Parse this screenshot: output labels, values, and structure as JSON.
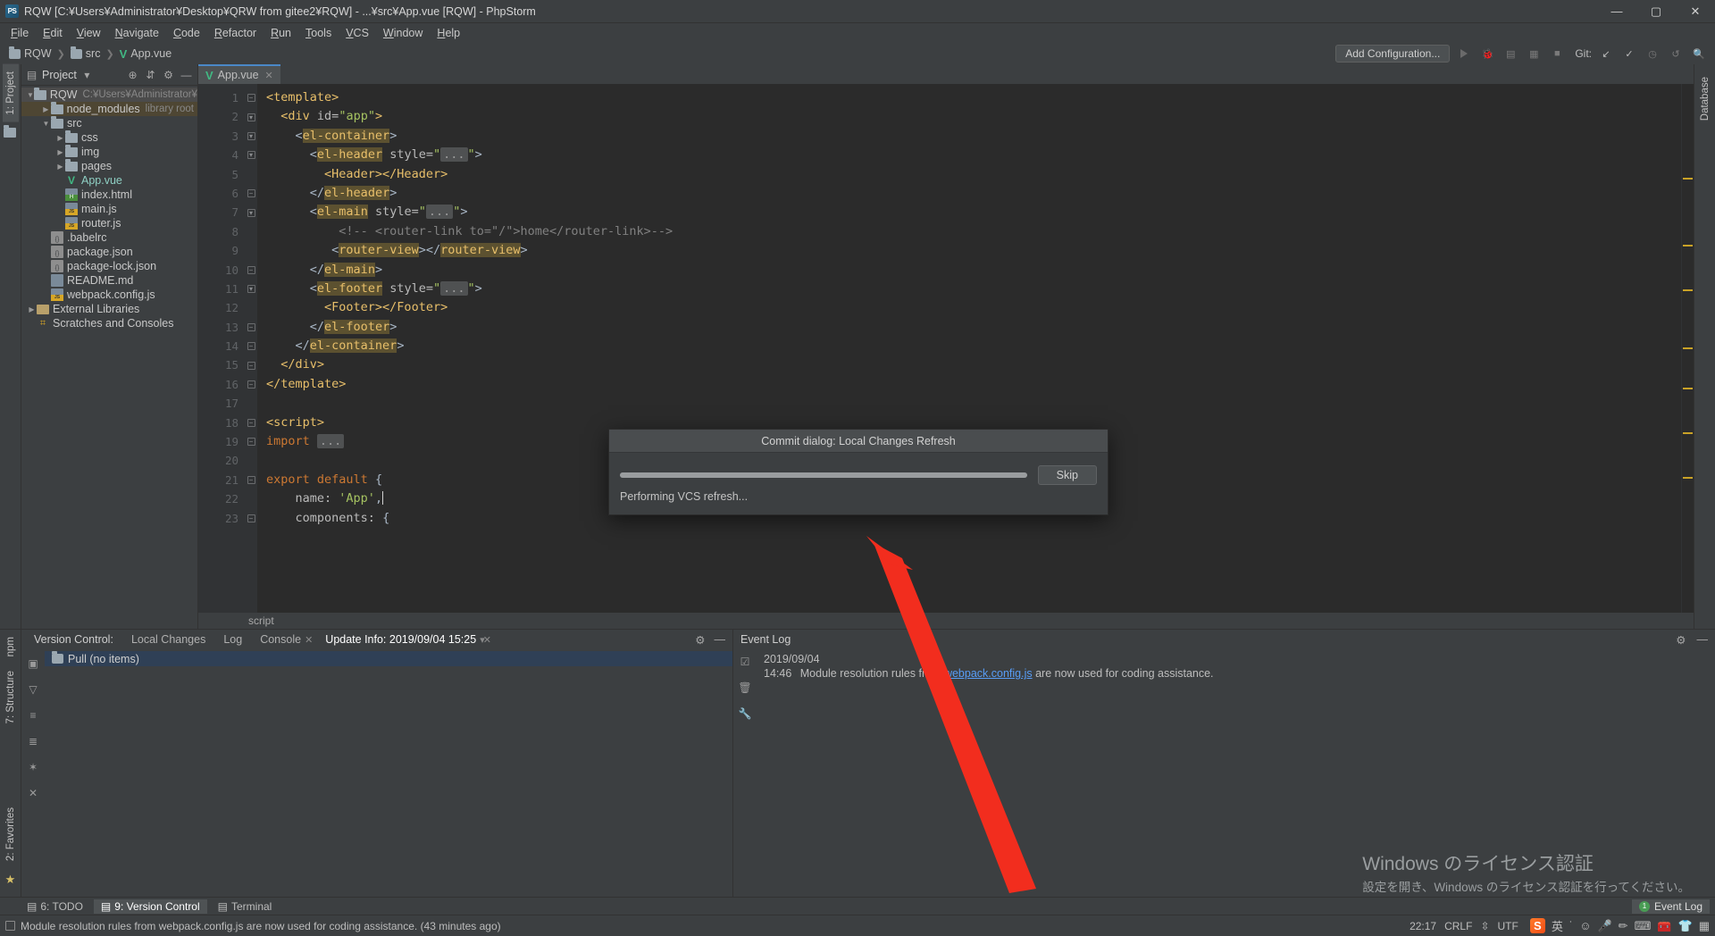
{
  "window": {
    "title": "RQW [C:¥Users¥Administrator¥Desktop¥QRW from gitee2¥RQW] - ...¥src¥App.vue [RQW] - PhpStorm",
    "logo": "PS",
    "minimize": "—",
    "maximize": "▢",
    "close": "✕"
  },
  "menu": [
    "File",
    "Edit",
    "View",
    "Navigate",
    "Code",
    "Refactor",
    "Run",
    "Tools",
    "VCS",
    "Window",
    "Help"
  ],
  "navbar": {
    "crumbs": [
      "RQW",
      "src",
      "App.vue"
    ],
    "add_configuration": "Add Configuration...",
    "git_label": "Git:"
  },
  "left_strip": {
    "project_tab": "1: Project"
  },
  "right_strip": {
    "database_tab": "Database"
  },
  "left_bottom_strips": {
    "npm_tab": "npm",
    "structure_tab": "7: Structure",
    "favorites_tab": "2: Favorites"
  },
  "project_panel": {
    "title": "Project",
    "tree": [
      {
        "indent": 0,
        "arrow": "down",
        "icon": "folder",
        "label": "RQW",
        "hint": "C:¥Users¥Administrator¥Desktop¥",
        "state": "selected-root"
      },
      {
        "indent": 1,
        "arrow": "right",
        "icon": "folder",
        "label": "node_modules",
        "hint": "library root",
        "state": "highlighted"
      },
      {
        "indent": 1,
        "arrow": "down",
        "icon": "folder",
        "label": "src",
        "hint": ""
      },
      {
        "indent": 2,
        "arrow": "right",
        "icon": "folder",
        "label": "css",
        "hint": ""
      },
      {
        "indent": 2,
        "arrow": "right",
        "icon": "folder",
        "label": "img",
        "hint": ""
      },
      {
        "indent": 2,
        "arrow": "right",
        "icon": "folder",
        "label": "pages",
        "hint": ""
      },
      {
        "indent": 2,
        "arrow": "none",
        "icon": "vue",
        "label": "App.vue",
        "hint": "",
        "state": "active-file"
      },
      {
        "indent": 2,
        "arrow": "none",
        "icon": "html",
        "label": "index.html",
        "hint": ""
      },
      {
        "indent": 2,
        "arrow": "none",
        "icon": "js",
        "label": "main.js",
        "hint": ""
      },
      {
        "indent": 2,
        "arrow": "none",
        "icon": "js",
        "label": "router.js",
        "hint": ""
      },
      {
        "indent": 1,
        "arrow": "none",
        "icon": "json",
        "label": ".babelrc",
        "hint": ""
      },
      {
        "indent": 1,
        "arrow": "none",
        "icon": "json",
        "label": "package.json",
        "hint": ""
      },
      {
        "indent": 1,
        "arrow": "none",
        "icon": "json",
        "label": "package-lock.json",
        "hint": ""
      },
      {
        "indent": 1,
        "arrow": "none",
        "icon": "md",
        "label": "README.md",
        "hint": ""
      },
      {
        "indent": 1,
        "arrow": "none",
        "icon": "js",
        "label": "webpack.config.js",
        "hint": ""
      },
      {
        "indent": 0,
        "arrow": "right",
        "icon": "lib",
        "label": "External Libraries",
        "hint": ""
      },
      {
        "indent": 0,
        "arrow": "none",
        "icon": "scratch",
        "label": "Scratches and Consoles",
        "hint": ""
      }
    ]
  },
  "editor": {
    "tab": {
      "label": "App.vue",
      "icon": "vue-icon",
      "close": "✕"
    },
    "breadcrumb": "script",
    "lines": [
      {
        "n": 1,
        "fold": "minus",
        "html": "<span class='tag'>&lt;template&gt;</span>"
      },
      {
        "n": 2,
        "fold": "down",
        "html": "  <span class='tag'>&lt;div</span> <span class='attr'>id=</span><span class='str'>\"app\"</span><span class='tag'>&gt;</span>"
      },
      {
        "n": 3,
        "fold": "down",
        "html": "    <span class='punct'>&lt;</span><span class='tagbg'>el-container</span><span class='punct'>&gt;</span>"
      },
      {
        "n": 4,
        "fold": "down",
        "html": "      <span class='punct'>&lt;</span><span class='tagbg'>el-header</span> <span class='attr'>style=</span><span class='str'>\"</span><span class='fold-ell'>...</span><span class='str'>\"</span><span class='punct'>&gt;</span>"
      },
      {
        "n": 5,
        "fold": "none",
        "html": "        <span class='tag'>&lt;Header&gt;&lt;/Header&gt;</span>"
      },
      {
        "n": 6,
        "fold": "up",
        "html": "      <span class='punct'>&lt;/</span><span class='tagbg'>el-header</span><span class='punct'>&gt;</span>"
      },
      {
        "n": 7,
        "fold": "down",
        "html": "      <span class='punct'>&lt;</span><span class='tagbg'>el-main</span> <span class='attr'>style=</span><span class='str'>\"</span><span class='fold-ell'>...</span><span class='str'>\"</span><span class='punct'>&gt;</span>"
      },
      {
        "n": 8,
        "fold": "none",
        "html": "          <span class='cmt'>&lt;!-- &lt;router-link to=\"/\"&gt;home&lt;/router-link&gt;--&gt;</span>"
      },
      {
        "n": 9,
        "fold": "none",
        "html": "         <span class='punct'>&lt;</span><span class='tagbg'>router-view</span><span class='punct'>&gt;&lt;/</span><span class='tagbg'>router-view</span><span class='punct'>&gt;</span>"
      },
      {
        "n": 10,
        "fold": "up",
        "html": "      <span class='punct'>&lt;/</span><span class='tagbg'>el-main</span><span class='punct'>&gt;</span>"
      },
      {
        "n": 11,
        "fold": "down",
        "html": "      <span class='punct'>&lt;</span><span class='tagbg'>el-footer</span> <span class='attr'>style=</span><span class='str'>\"</span><span class='fold-ell'>...</span><span class='str'>\"</span><span class='punct'>&gt;</span>"
      },
      {
        "n": 12,
        "fold": "none",
        "html": "        <span class='tag'>&lt;Footer&gt;&lt;/Footer&gt;</span>"
      },
      {
        "n": 13,
        "fold": "up",
        "html": "      <span class='punct'>&lt;/</span><span class='tagbg'>el-footer</span><span class='punct'>&gt;</span>"
      },
      {
        "n": 14,
        "fold": "up",
        "html": "    <span class='punct'>&lt;/</span><span class='tagbg'>el-container</span><span class='punct'>&gt;</span>"
      },
      {
        "n": 15,
        "fold": "up",
        "html": "  <span class='tag'>&lt;/div&gt;</span>"
      },
      {
        "n": 16,
        "fold": "up",
        "html": "<span class='tag'>&lt;/template&gt;</span>"
      },
      {
        "n": 17,
        "fold": "none",
        "html": ""
      },
      {
        "n": 18,
        "fold": "minus",
        "html": "<span class='tag'>&lt;script&gt;</span>"
      },
      {
        "n": 19,
        "fold": "minus",
        "html": "<span class='kw'>import</span> <span class='fold-ell'>...</span>"
      },
      {
        "n": 20,
        "fold": "none",
        "html": ""
      },
      {
        "n": 21,
        "fold": "minus",
        "html": "<span class='kw'>export default</span> <span class='punct'>{</span>"
      },
      {
        "n": 22,
        "fold": "none",
        "html": "    <span class='attr'>name:</span> <span class='str'>'App'</span><span class='punct'>,</span><span class='caret'></span>"
      },
      {
        "n": 23,
        "fold": "minus",
        "html": "    <span class='attr'>components:</span> <span class='punct'>{</span>"
      }
    ]
  },
  "dialog": {
    "title": "Commit dialog: Local Changes Refresh",
    "status": "Performing VCS refresh...",
    "button": "Skip",
    "progress_percent": 100
  },
  "version_control": {
    "tabs": [
      "Version Control:",
      "Local Changes",
      "Log",
      "Console",
      "Update Info: 2019/09/04 15:25"
    ],
    "row": "Pull (no items)"
  },
  "event_log": {
    "title": "Event Log",
    "date": "2019/09/04",
    "time": "14:46",
    "message_before": "Module resolution rules from ",
    "link": "webpack.config.js",
    "message_after": " are now used for coding assistance."
  },
  "watermark": {
    "line1": "Windows のライセンス認証",
    "line2": "設定を開き、Windows のライセンス認証を行ってください。"
  },
  "tool_tabs": [
    {
      "label": "6: TODO",
      "selected": false
    },
    {
      "label": "9: Version Control",
      "selected": true
    },
    {
      "label": "Terminal",
      "selected": false
    }
  ],
  "event_log_button": {
    "label": "Event Log",
    "count": "1"
  },
  "statusbar": {
    "message": "Module resolution rules from webpack.config.js are now used for coding assistance. (43 minutes ago)",
    "time": "22:17",
    "line_separator": "CRLF",
    "encoding": "UTF",
    "ime": "英"
  },
  "colors": {
    "accent_blue": "#4a88c7",
    "vue_green": "#41b883",
    "tag_yellow": "#e8bf6a",
    "string_green": "#a5c261",
    "link_blue": "#589df6",
    "arrow_red": "#f22d1e",
    "panel_bg": "#3c3f41",
    "editor_bg": "#2b2b2b"
  }
}
